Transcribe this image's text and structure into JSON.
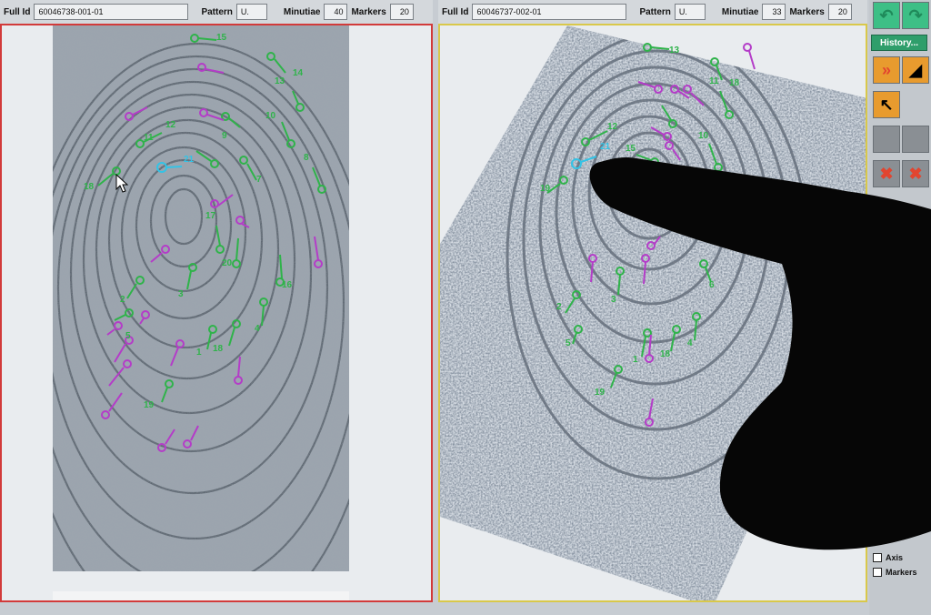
{
  "left": {
    "full_id_label": "Full Id",
    "full_id": "60046738-001-01",
    "pattern_label": "Pattern",
    "pattern": "U.",
    "minutiae_label": "Minutiae",
    "minutiae": "40",
    "markers_label": "Markers",
    "markers": "20",
    "labels": [
      "15",
      "14",
      "13",
      "12",
      "11",
      "10",
      "9",
      "8",
      "7",
      "21",
      "18",
      "17",
      "20",
      "16",
      "2",
      "3",
      "4",
      "5",
      "1",
      "18",
      "19"
    ]
  },
  "right": {
    "full_id_label": "Full Id",
    "full_id": "60046737-002-01",
    "pattern_label": "Pattern",
    "pattern": "U.",
    "minutiae_label": "Minutiae",
    "minutiae": "33",
    "markers_label": "Markers",
    "markers": "20",
    "labels": [
      "13",
      "11",
      "18",
      "12",
      "21",
      "15",
      "10",
      "19",
      "2",
      "3",
      "6",
      "5",
      "1",
      "18",
      "4",
      "19"
    ]
  },
  "sidebar": {
    "history_label": "History...",
    "checkboxes": [
      "Axis",
      "Markers"
    ]
  },
  "colors": {
    "minutia_green": "#2fb34a",
    "minutia_magenta": "#b43cc8",
    "minutia_cyan": "#33c3e6",
    "left_border": "#d23a3a",
    "right_border": "#d9c84a"
  }
}
